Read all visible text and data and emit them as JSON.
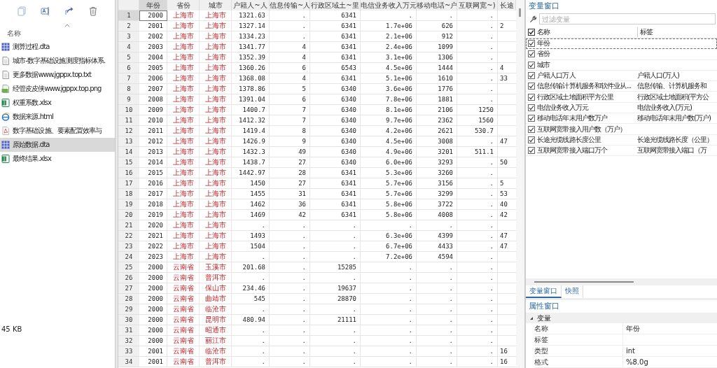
{
  "file_explorer": {
    "column_header": "名称",
    "files": [
      {
        "name": "测算过程.dta",
        "kind": "dta",
        "selected": false
      },
      {
        "name": "城市-数字基础设施测度指标体系.",
        "kind": "doc",
        "selected": false
      },
      {
        "name": "更多数据www.jgppx.top.txt",
        "kind": "doc",
        "selected": false
      },
      {
        "name": "经管皮皮侠www.jgppx.top.png",
        "kind": "png",
        "selected": false
      },
      {
        "name": "权重系数.xlsx",
        "kind": "xlsx",
        "selected": false
      },
      {
        "name": "数据来源.html",
        "kind": "html",
        "selected": false
      },
      {
        "name": "数字基础设施、要素配置效率与",
        "kind": "pdf",
        "selected": false
      },
      {
        "name": "原始数据.dta",
        "kind": "dta",
        "selected": true
      },
      {
        "name": "最终结果.xlsx",
        "kind": "xlsx",
        "selected": false
      }
    ],
    "status": "45 KB"
  },
  "data_grid": {
    "columns": [
      {
        "label": "年份",
        "kind": "number",
        "selected": true
      },
      {
        "label": "省份",
        "kind": "string",
        "selected": false
      },
      {
        "label": "城市",
        "kind": "string",
        "selected": false
      },
      {
        "label": "户籍人~人",
        "kind": "number",
        "selected": false
      },
      {
        "label": "信息传输~人",
        "kind": "number",
        "selected": false
      },
      {
        "label": "行政区域土~里",
        "kind": "number",
        "selected": false
      },
      {
        "label": "电信业务收入万元",
        "kind": "number",
        "selected": false
      },
      {
        "label": "移动电话~户",
        "kind": "number",
        "selected": false
      },
      {
        "label": "互联网宽~)",
        "kind": "number",
        "selected": false
      },
      {
        "label": "长途",
        "kind": "number",
        "selected": false
      }
    ],
    "rows": [
      {
        "number": "1",
        "selected": true,
        "cells": [
          "2000",
          "上海市",
          "上海市",
          "1321.63",
          ".",
          "6341",
          ".",
          ".",
          "."
        ]
      },
      {
        "number": "2",
        "selected": false,
        "cells": [
          "2001",
          "上海市",
          "上海市",
          "1327.14",
          ".",
          "6341",
          "1.7e+06",
          "626",
          "."
        ],
        "tail": "2"
      },
      {
        "number": "3",
        "selected": false,
        "cells": [
          "2002",
          "上海市",
          "上海市",
          "1334.23",
          ".",
          "6341",
          "2.1e+06",
          "912",
          "."
        ]
      },
      {
        "number": "4",
        "selected": false,
        "cells": [
          "2003",
          "上海市",
          "上海市",
          "1341.77",
          "4",
          "6341",
          "2.4e+06",
          "1099",
          "."
        ]
      },
      {
        "number": "5",
        "selected": false,
        "cells": [
          "2004",
          "上海市",
          "上海市",
          "1352.39",
          "4",
          "6341",
          "3.1e+06",
          "1306",
          "."
        ]
      },
      {
        "number": "6",
        "selected": false,
        "cells": [
          "2005",
          "上海市",
          "上海市",
          "1360.26",
          "6",
          "6543",
          "4.5e+06",
          "1444",
          "."
        ],
        "tail": "4"
      },
      {
        "number": "7",
        "selected": false,
        "cells": [
          "2006",
          "上海市",
          "上海市",
          "1368.08",
          "4",
          "6341",
          "5.1e+06",
          "1610",
          "."
        ],
        "tail": "33"
      },
      {
        "number": "8",
        "selected": false,
        "cells": [
          "2007",
          "上海市",
          "上海市",
          "1378.86",
          "5",
          "6340",
          "3.6e+06",
          "1776",
          "."
        ]
      },
      {
        "number": "9",
        "selected": false,
        "cells": [
          "2008",
          "上海市",
          "上海市",
          "1391.04",
          "6",
          "6340",
          "7.8e+06",
          "1881",
          "."
        ]
      },
      {
        "number": "10",
        "selected": false,
        "cells": [
          "2009",
          "上海市",
          "上海市",
          "1400.7",
          "7",
          "6340",
          "8.1e+06",
          "2106",
          "1250"
        ]
      },
      {
        "number": "11",
        "selected": false,
        "cells": [
          "2010",
          "上海市",
          "上海市",
          "1412.32",
          "7",
          "6340",
          "9.7e+06",
          "2362",
          "1560"
        ]
      },
      {
        "number": "12",
        "selected": false,
        "cells": [
          "2011",
          "上海市",
          "上海市",
          "1419.4",
          "8",
          "6340",
          "4.2e+06",
          "2621",
          "530.7"
        ]
      },
      {
        "number": "13",
        "selected": false,
        "cells": [
          "2012",
          "上海市",
          "上海市",
          "1426.9",
          "9",
          "6340",
          "4.5e+06",
          "3008",
          "."
        ],
        "tail": "47"
      },
      {
        "number": "14",
        "selected": false,
        "cells": [
          "2013",
          "上海市",
          "上海市",
          "1432.3",
          "49",
          "6340",
          "4.9e+06",
          "3201",
          "511.1"
        ]
      },
      {
        "number": "15",
        "selected": false,
        "cells": [
          "2014",
          "上海市",
          "上海市",
          "1438.7",
          "27",
          "6340",
          "6.0e+06",
          "3293",
          "."
        ],
        "tail": "50"
      },
      {
        "number": "16",
        "selected": false,
        "cells": [
          "2015",
          "上海市",
          "上海市",
          "1442.97",
          "28",
          "6341",
          "5.3e+06",
          "3260",
          "."
        ]
      },
      {
        "number": "17",
        "selected": false,
        "cells": [
          "2016",
          "上海市",
          "上海市",
          "1450",
          "27",
          "6341",
          "5.7e+06",
          "3156",
          "."
        ],
        "tail": "5"
      },
      {
        "number": "18",
        "selected": false,
        "cells": [
          "2017",
          "上海市",
          "上海市",
          "1455",
          "31",
          "6341",
          "5.7e+06",
          "3299",
          "."
        ],
        "tail": "53"
      },
      {
        "number": "19",
        "selected": false,
        "cells": [
          "2018",
          "上海市",
          "上海市",
          "1462",
          "36",
          "6341",
          "5.8e+06",
          "3722",
          "."
        ],
        "tail": "40"
      },
      {
        "number": "20",
        "selected": false,
        "cells": [
          "2019",
          "上海市",
          "上海市",
          "1469",
          "42",
          "6341",
          "5.8e+06",
          "4008",
          "."
        ],
        "tail": "42"
      },
      {
        "number": "21",
        "selected": false,
        "cells": [
          "2020",
          "上海市",
          "上海市",
          ".",
          ".",
          ".",
          ".",
          ".",
          "."
        ]
      },
      {
        "number": "22",
        "selected": false,
        "cells": [
          "2021",
          "上海市",
          "上海市",
          "1493",
          ".",
          ".",
          "6.3e+06",
          "4399",
          "."
        ],
        "tail": "47"
      },
      {
        "number": "23",
        "selected": false,
        "cells": [
          "2022",
          "上海市",
          "上海市",
          "1504",
          ".",
          ".",
          "6.7e+06",
          "4433",
          "."
        ],
        "tail": "47"
      },
      {
        "number": "24",
        "selected": false,
        "cells": [
          "2023",
          "上海市",
          "上海市",
          ".",
          ".",
          ".",
          "7.2e+06",
          "4594",
          "."
        ]
      },
      {
        "number": "25",
        "selected": false,
        "cells": [
          "2000",
          "云南省",
          "玉溪市",
          "201.68",
          ".",
          "15285",
          ".",
          ".",
          "."
        ]
      },
      {
        "number": "26",
        "selected": false,
        "cells": [
          "2000",
          "云南省",
          "普洱市",
          ".",
          ".",
          ".",
          ".",
          ".",
          "."
        ]
      },
      {
        "number": "27",
        "selected": false,
        "cells": [
          "2000",
          "云南省",
          "保山市",
          "234.46",
          ".",
          "19637",
          ".",
          ".",
          "."
        ]
      },
      {
        "number": "28",
        "selected": false,
        "cells": [
          "2000",
          "云南省",
          "曲靖市",
          "545",
          ".",
          "28870",
          ".",
          ".",
          "."
        ]
      },
      {
        "number": "29",
        "selected": false,
        "cells": [
          "2000",
          "云南省",
          "临沧市",
          ".",
          ".",
          ".",
          ".",
          ".",
          "."
        ]
      },
      {
        "number": "30",
        "selected": false,
        "cells": [
          "2000",
          "云南省",
          "昆明市",
          "480.94",
          ".",
          "21111",
          ".",
          ".",
          "."
        ]
      },
      {
        "number": "31",
        "selected": false,
        "cells": [
          "2000",
          "云南省",
          "昭通市",
          ".",
          ".",
          ".",
          ".",
          ".",
          "."
        ]
      },
      {
        "number": "32",
        "selected": false,
        "cells": [
          "2000",
          "云南省",
          "丽江市",
          ".",
          ".",
          ".",
          ".",
          ".",
          "."
        ]
      },
      {
        "number": "33",
        "selected": false,
        "cells": [
          "2001",
          "云南省",
          "临沧市",
          ".",
          ".",
          ".",
          ".",
          ".",
          "."
        ],
        "tail": "16"
      },
      {
        "number": "34",
        "selected": false,
        "cells": [
          "2001",
          "云南省",
          "普洱市",
          ".",
          ".",
          ".",
          ".",
          ".",
          "."
        ],
        "tail": "16"
      }
    ]
  },
  "variables_window": {
    "title": "变量窗口",
    "filter": {
      "placeholder": "过滤变量"
    },
    "header": {
      "checked": true,
      "name": "名称",
      "label": "标签"
    },
    "variables": [
      {
        "name": "年份",
        "checked": true,
        "selected": true
      },
      {
        "name": "省份",
        "checked": true,
        "selected": false
      },
      {
        "name": "城市",
        "checked": true,
        "selected": false
      },
      {
        "name": "户籍人口万人",
        "label": "户籍人口(万人)",
        "checked": true,
        "selected": false
      },
      {
        "name": "信息传输计算机服务和软件业从...",
        "label": "信息传输、计算机服务和",
        "checked": true,
        "selected": false
      },
      {
        "name": "行政区域土地面积平方公里",
        "label": "行政区域土地面积(平方公",
        "checked": true,
        "selected": false
      },
      {
        "name": "电信业务收入万元",
        "label": "电信业务收入(万元)",
        "checked": true,
        "selected": false
      },
      {
        "name": "移动电话年末用户数万户",
        "label": "移动电话年末用户数(万户)",
        "checked": true,
        "selected": false
      },
      {
        "name": "互联网宽带接入用户数（万户）",
        "checked": true,
        "selected": false
      },
      {
        "name": "长途光缆线路长度公里",
        "label": "长途光缆线路长度（公里）",
        "checked": true,
        "selected": false
      },
      {
        "name": "互联网宽带接入端口万个",
        "label": "互联网宽带接入端口（万",
        "checked": true,
        "selected": false
      }
    ]
  },
  "tabs": [
    {
      "label": "变量窗口",
      "selected": true
    },
    {
      "label": "快照",
      "selected": false
    }
  ],
  "properties_window": {
    "title": "属性窗口",
    "group": {
      "label": "变量",
      "expanded": true
    },
    "properties": [
      {
        "name": "名称",
        "value": "年份"
      },
      {
        "name": "标签"
      },
      {
        "name": "类型",
        "value": "int"
      },
      {
        "name": "格式",
        "value": "%8.0g"
      }
    ]
  }
}
